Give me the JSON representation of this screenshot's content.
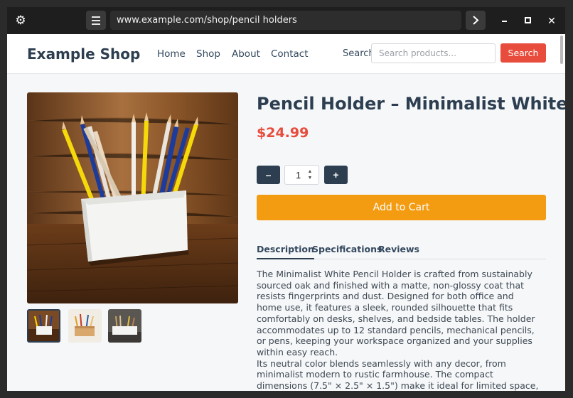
{
  "browser": {
    "url": "www.example.com/shop/pencil holders",
    "close_glyph": "✕"
  },
  "header": {
    "brand": "Example Shop",
    "nav": [
      "Home",
      "Shop",
      "About",
      "Contact"
    ],
    "search_label": "Search",
    "search_placeholder": "Search products...",
    "search_button": "Search"
  },
  "product": {
    "title": "Pencil Holder – Minimalist White",
    "price": "$24.99",
    "quantity": "1",
    "minus_label": "–",
    "plus_label": "+",
    "add_to_cart": "Add to Cart",
    "tabs": [
      "Description",
      "Specifications",
      "Reviews"
    ],
    "active_tab": "Description",
    "description_p1": "The Minimalist White Pencil Holder is crafted from sustainably sourced oak and finished with a matte, non-glossy coat that resists fingerprints and dust. Designed for both office and home use, it features a sleek, rounded silhouette that fits comfortably on desks, shelves, and bedside tables. The holder accommodates up to 12 standard pencils, mechanical pencils, or pens, keeping your workspace organized and your supplies within easy reach.",
    "description_p2": "Its neutral color blends seamlessly with any decor, from minimalist modern to rustic farmhouse. The compact dimensions (7.5\" × 2.5\" × 1.5\") make it ideal for limited space, while the sturdy base ensures stability on uneven surfaces. Ideal for students, artists, and"
  },
  "colors": {
    "brand_dark": "#2c3e50",
    "accent_red": "#e74c3c",
    "cart_orange": "#f39c12"
  },
  "icons": {
    "settings": "gear-icon",
    "menu": "hamburger-icon",
    "go": "chevron-right-icon",
    "minimize": "minimize-icon",
    "maximize": "maximize-icon",
    "close": "close-icon"
  }
}
